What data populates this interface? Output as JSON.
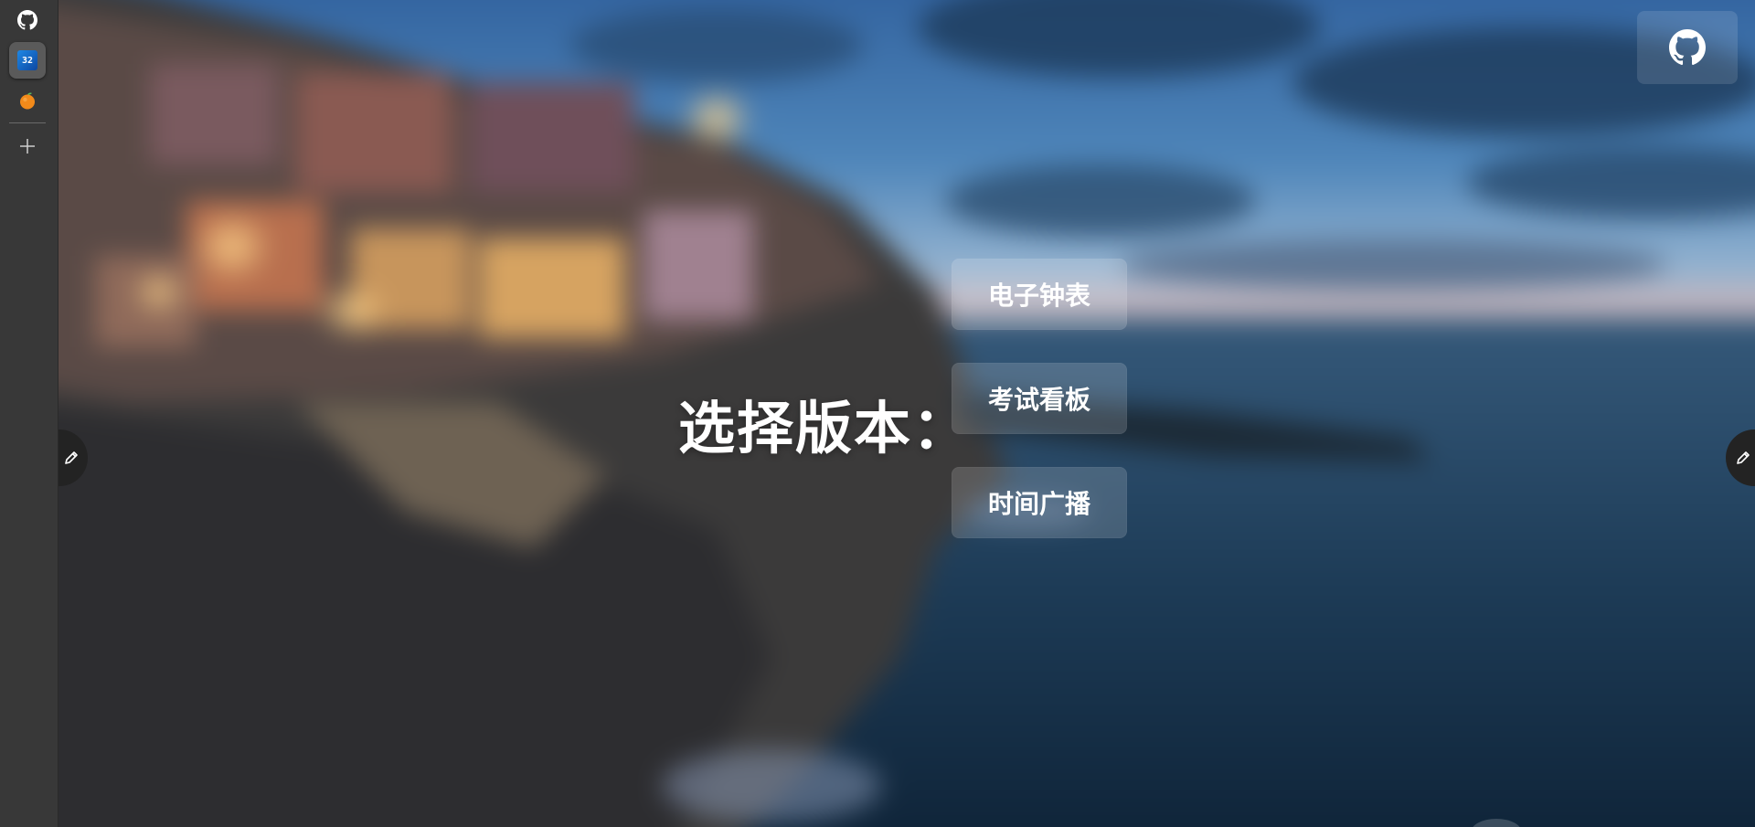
{
  "dock": {
    "items": [
      {
        "icon": "github-icon",
        "active": false
      },
      {
        "icon": "app-tile-icon",
        "tile_text": "32",
        "active": true
      },
      {
        "icon": "orange-icon",
        "active": false
      }
    ],
    "add_icon": "plus-icon"
  },
  "main": {
    "title": "选择版本：",
    "buttons": [
      {
        "label": "电子钟表"
      },
      {
        "label": "考试看板"
      },
      {
        "label": "时间广播"
      }
    ],
    "corner_icon": "github-icon",
    "side_icon": "pencil-icon"
  },
  "colors": {
    "dock_bg": "#383838",
    "text": "#ffffff",
    "button_bg": "rgba(255,255,255,0.16)"
  }
}
